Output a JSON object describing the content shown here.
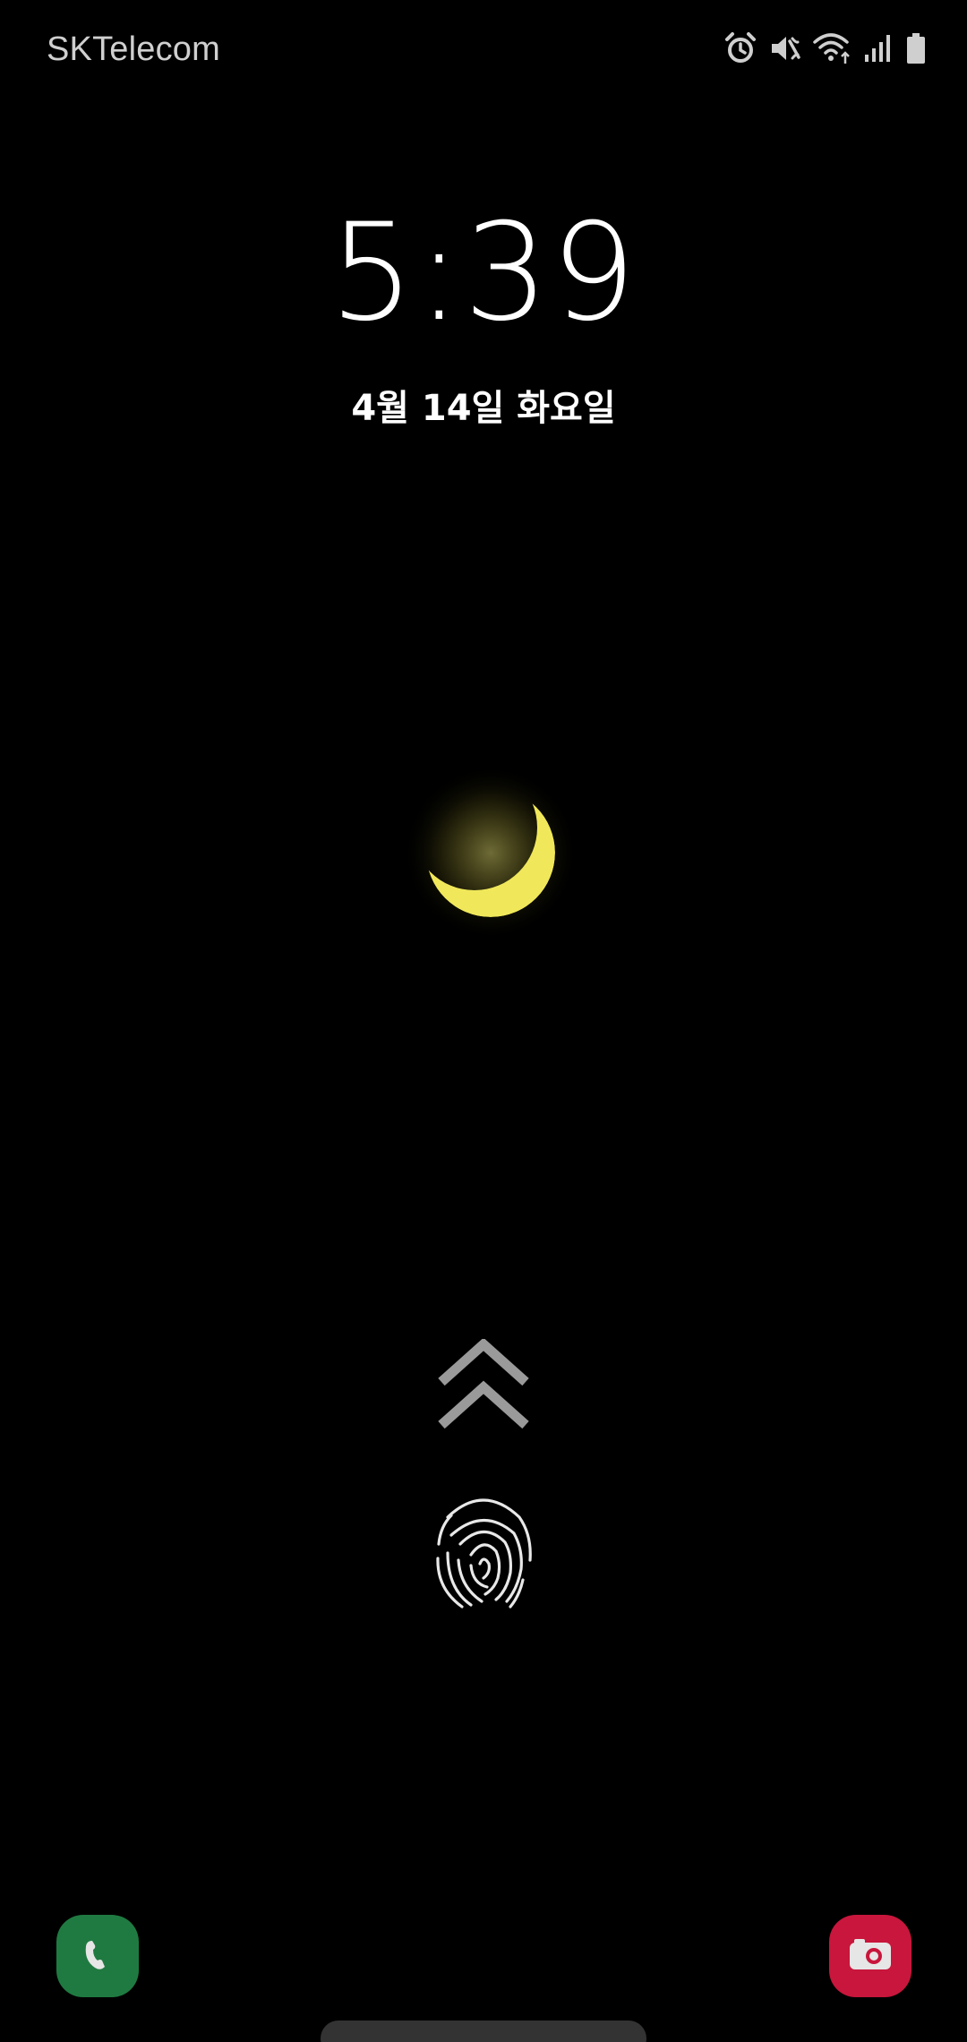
{
  "status_bar": {
    "carrier": "SKTelecom",
    "icons": [
      "alarm-icon",
      "mute-icon",
      "wifi-icon",
      "signal-icon",
      "battery-icon"
    ]
  },
  "lock_screen": {
    "time": "5:39",
    "date": "4월 14일 화요일"
  },
  "wallpaper": {
    "subject": "crescent-moon",
    "moon_color": "#f0e85a"
  },
  "shortcuts": {
    "left": "phone-icon",
    "right": "camera-icon",
    "phone_color": "#1f7a41",
    "camera_color": "#c8163c"
  },
  "unlock": {
    "swipe_icon": "double-chevron-up-icon",
    "biometric_icon": "fingerprint-icon"
  }
}
